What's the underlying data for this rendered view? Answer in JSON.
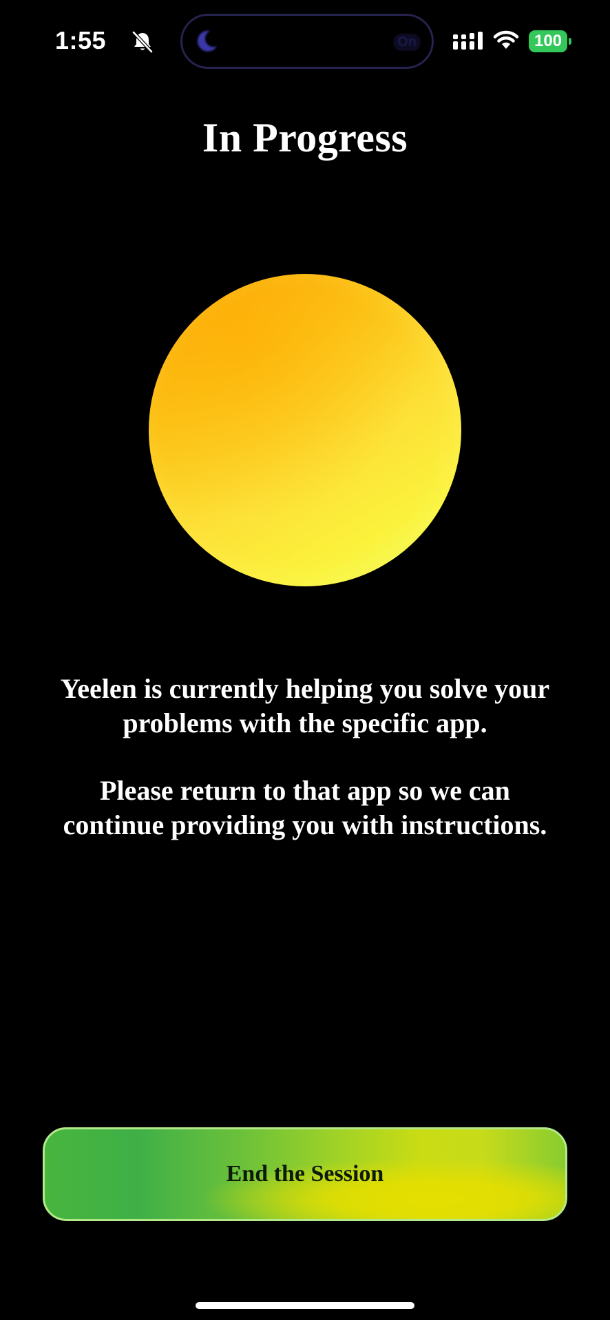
{
  "status_bar": {
    "time": "1:55",
    "silent_icon": "bell-slash-icon",
    "dynamic_island": {
      "moon_icon": "moon-icon",
      "focus_label": "On"
    },
    "signal_icon": "cellular-signal-icon",
    "wifi_icon": "wifi-icon",
    "battery_level": "100",
    "battery_color": "#34c759"
  },
  "main": {
    "title": "In Progress",
    "orb_colors": [
      "#fba90d",
      "#fde036",
      "#eefe5c"
    ],
    "message_line_1": "Yeelen is currently helping you solve your problems with the specific app.",
    "message_line_2": "Please return to that app so we can continue providing you with instructions."
  },
  "footer": {
    "end_button_label": "End the Session",
    "button_colors": [
      "#47b53e",
      "#c9dc14",
      "#e5de00"
    ]
  }
}
